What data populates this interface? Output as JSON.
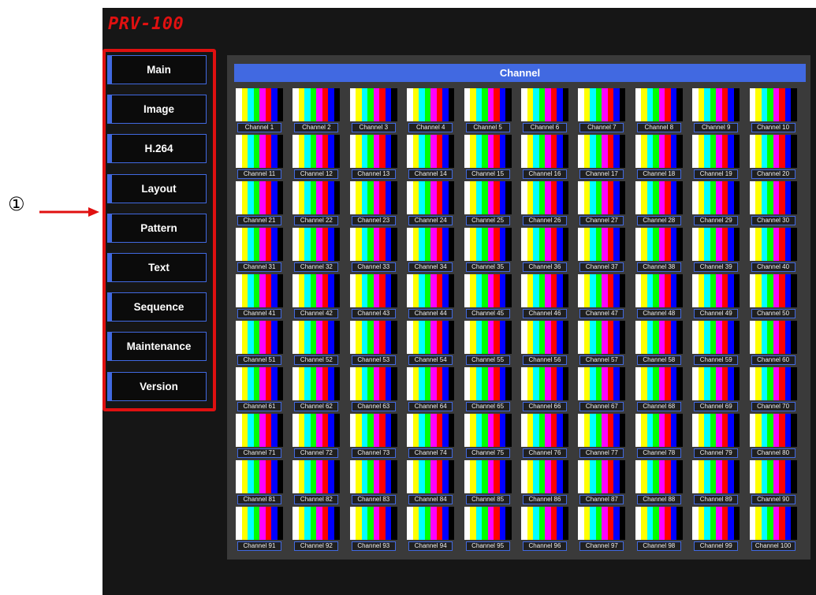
{
  "annotation": {
    "marker": "①"
  },
  "app": {
    "title": "PRV-100"
  },
  "menu": {
    "items": [
      {
        "label": "Main",
        "name": "menu-main-button"
      },
      {
        "label": "Image",
        "name": "menu-image-button"
      },
      {
        "label": "H.264",
        "name": "menu-h264-button"
      },
      {
        "label": "Layout",
        "name": "menu-layout-button"
      },
      {
        "label": "Pattern",
        "name": "menu-pattern-button"
      },
      {
        "label": "Text",
        "name": "menu-text-button"
      },
      {
        "label": "Sequence",
        "name": "menu-sequence-button"
      },
      {
        "label": "Maintenance",
        "name": "menu-maintenance-button"
      },
      {
        "label": "Version",
        "name": "menu-version-button"
      }
    ]
  },
  "panel": {
    "title": "Channel",
    "channels": [
      "Channel 1",
      "Channel 2",
      "Channel 3",
      "Channel 4",
      "Channel 5",
      "Channel 6",
      "Channel 7",
      "Channel 8",
      "Channel 9",
      "Channel 10",
      "Channel 11",
      "Channel 12",
      "Channel 13",
      "Channel 14",
      "Channel 15",
      "Channel 16",
      "Channel 17",
      "Channel 18",
      "Channel 19",
      "Channel 20",
      "Channel 21",
      "Channel 22",
      "Channel 23",
      "Channel 24",
      "Channel 25",
      "Channel 26",
      "Channel 27",
      "Channel 28",
      "Channel 29",
      "Channel 30",
      "Channel 31",
      "Channel 32",
      "Channel 33",
      "Channel 34",
      "Channel 35",
      "Channel 36",
      "Channel 37",
      "Channel 38",
      "Channel 39",
      "Channel 40",
      "Channel 41",
      "Channel 42",
      "Channel 43",
      "Channel 44",
      "Channel 45",
      "Channel 46",
      "Channel 47",
      "Channel 48",
      "Channel 49",
      "Channel 50",
      "Channel 51",
      "Channel 52",
      "Channel 53",
      "Channel 54",
      "Channel 55",
      "Channel 56",
      "Channel 57",
      "Channel 58",
      "Channel 59",
      "Channel 60",
      "Channel 61",
      "Channel 62",
      "Channel 63",
      "Channel 64",
      "Channel 65",
      "Channel 66",
      "Channel 67",
      "Channel 68",
      "Channel 69",
      "Channel 70",
      "Channel 71",
      "Channel 72",
      "Channel 73",
      "Channel 74",
      "Channel 75",
      "Channel 76",
      "Channel 77",
      "Channel 78",
      "Channel 79",
      "Channel 80",
      "Channel 81",
      "Channel 82",
      "Channel 83",
      "Channel 84",
      "Channel 85",
      "Channel 86",
      "Channel 87",
      "Channel 88",
      "Channel 89",
      "Channel 90",
      "Channel 91",
      "Channel 92",
      "Channel 93",
      "Channel 94",
      "Channel 95",
      "Channel 96",
      "Channel 97",
      "Channel 98",
      "Channel 99",
      "Channel 100"
    ]
  },
  "thumbnail": {
    "bar_colors": [
      "#ffffff",
      "#ffff00",
      "#00ffff",
      "#00ff00",
      "#ff00ff",
      "#ff0000",
      "#0000ff",
      "#000000"
    ]
  },
  "colors": {
    "accent": "#4169e1",
    "title_red": "#e01010",
    "frame_red": "#e01010",
    "background": "#161616",
    "panel": "#3a3a3a"
  }
}
